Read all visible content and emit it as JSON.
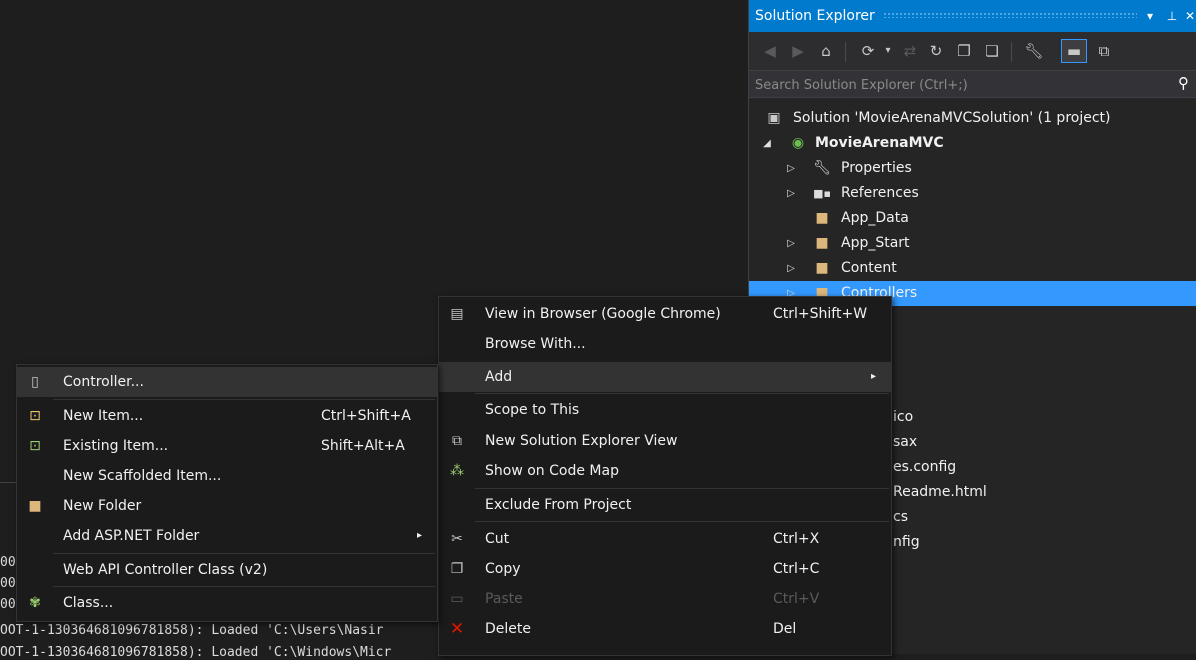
{
  "output": {
    "lines": [
      "00",
      "00",
      "00",
      "OOT-1-130364681096781858): Loaded 'C:\\Users\\Nasir",
      "OOT-1-130364681096781858): Loaded 'C:\\Windows\\Micr"
    ]
  },
  "solution_explorer": {
    "title": "Solution Explorer",
    "title_buttons": [
      "▾",
      "⊥",
      "✕"
    ],
    "search_placeholder": "Search Solution Explorer (Ctrl+;)",
    "tree": [
      {
        "label": "Solution 'MovieArenaMVCSolution' (1 project)",
        "icon": "solution-icon"
      },
      {
        "label": "MovieArenaMVC",
        "icon": "web-project-icon",
        "expander": "◢"
      },
      {
        "label": "Properties",
        "icon": "wrench-icon",
        "expander": "▷"
      },
      {
        "label": "References",
        "icon": "references-icon",
        "expander": "▷"
      },
      {
        "label": "App_Data",
        "icon": "folder-icon"
      },
      {
        "label": "App_Start",
        "icon": "folder-icon",
        "expander": "▷"
      },
      {
        "label": "Content",
        "icon": "folder-icon",
        "expander": "▷"
      },
      {
        "label": "Controllers",
        "icon": "folder-icon",
        "expander": "▷",
        "selected": true
      }
    ],
    "partial_items": [
      "ico",
      "sax",
      "es.config",
      "Readme.html",
      "cs",
      "nfig"
    ]
  },
  "context_menu": {
    "items": [
      {
        "label": "View in Browser (Google Chrome)",
        "shortcut": "Ctrl+Shift+W",
        "icon": "browser-icon"
      },
      {
        "label": "Browse With..."
      },
      {
        "label": "Add",
        "submenu": "▸",
        "highlighted": true
      },
      {
        "label": "Scope to This"
      },
      {
        "label": "New Solution Explorer View",
        "icon": "new-view-icon"
      },
      {
        "label": "Show on Code Map",
        "icon": "code-map-icon"
      },
      {
        "label": "Exclude From Project"
      },
      {
        "label": "Cut",
        "shortcut": "Ctrl+X",
        "icon": "scissors-icon"
      },
      {
        "label": "Copy",
        "shortcut": "Ctrl+C",
        "icon": "copy-icon"
      },
      {
        "label": "Paste",
        "shortcut": "Ctrl+V",
        "icon": "paste-icon",
        "disabled": true
      },
      {
        "label": "Delete",
        "shortcut": "Del",
        "icon": "delete-icon",
        "color": "#e51400"
      }
    ]
  },
  "add_submenu": {
    "items": [
      {
        "label": "Controller...",
        "icon": "controller-icon",
        "highlighted": true
      },
      {
        "label": "New Item...",
        "shortcut": "Ctrl+Shift+A",
        "icon": "new-item-icon"
      },
      {
        "label": "Existing Item...",
        "shortcut": "Shift+Alt+A",
        "icon": "existing-item-icon"
      },
      {
        "label": "New Scaffolded Item..."
      },
      {
        "label": "New Folder",
        "icon": "new-folder-icon"
      },
      {
        "label": "Add ASP.NET Folder",
        "submenu": "▸"
      },
      {
        "label": "Web API Controller Class (v2)"
      },
      {
        "label": "Class...",
        "icon": "class-icon"
      }
    ]
  },
  "colors": {
    "accent": "#007acc",
    "selection": "#3399ff",
    "folder": "#dcb67a",
    "delete": "#e51400"
  }
}
